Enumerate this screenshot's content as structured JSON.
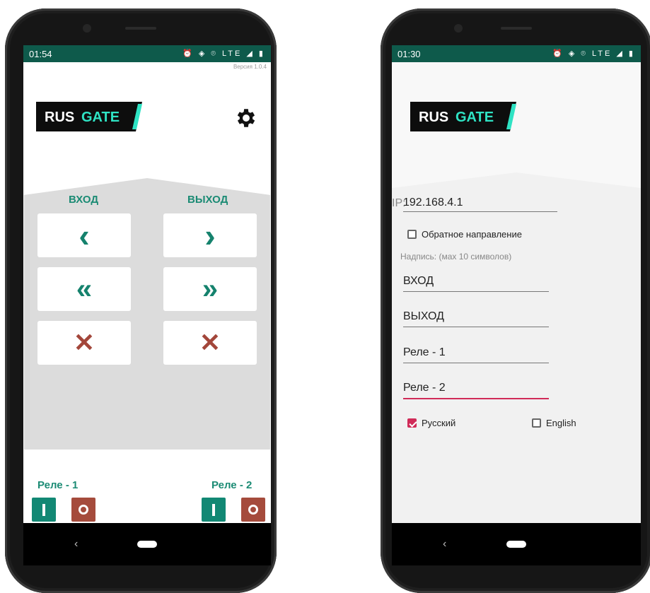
{
  "left_phone": {
    "status_time": "01:54",
    "status_icons": "⏰ ◈ ⌾ LTE ◢ ▮",
    "version": "Версия 1.0.4",
    "logo_text_a": "RUS",
    "logo_text_b": "GATE",
    "entry_label": "ВХОД",
    "exit_label": "ВЫХОД",
    "entry_buttons": [
      "‹",
      "«",
      "✕"
    ],
    "exit_buttons": [
      "›",
      "»",
      "✕"
    ],
    "relay1_label": "Реле - 1",
    "relay2_label": "Реле - 2",
    "relay_on_symbol": "I",
    "relay_off_symbol": "O"
  },
  "right_phone": {
    "status_time": "01:30",
    "status_icons": "⏰ ◈ ⌾ LTE ◢ ▮",
    "logo_text_a": "RUS",
    "logo_text_b": "GATE",
    "ip_label": "IP:",
    "ip_value": "192.168.4.1",
    "reverse_direction_label": "Обратное направление",
    "reverse_direction_checked": false,
    "caption_hint": "Надпись: (мах 10 символов)",
    "field_entry": "ВХОД",
    "field_exit": "ВЫХОД",
    "field_relay1": "Реле - 1",
    "field_relay2": "Реле - 2",
    "lang_russian_label": "Русский",
    "lang_russian_checked": true,
    "lang_english_label": "English",
    "lang_english_checked": false
  },
  "colors": {
    "status_bar": "#0e5a4b",
    "accent_teal": "#15826d",
    "accent_red": "#a3463a",
    "input_focus": "#d02b58",
    "logo_accent": "#2fe3c4"
  }
}
